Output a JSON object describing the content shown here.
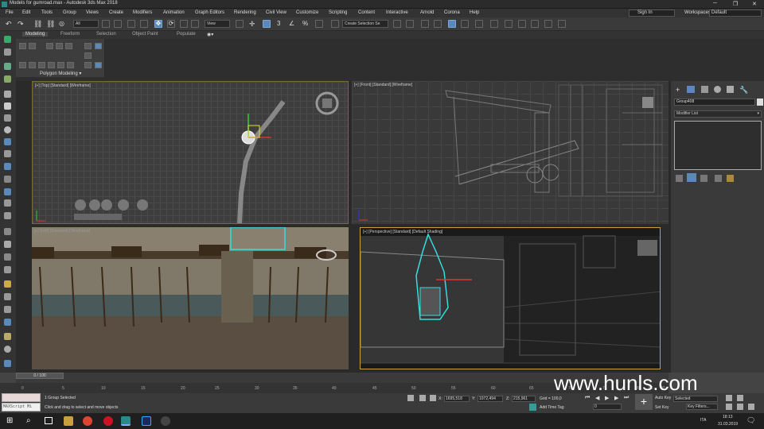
{
  "window": {
    "title": "Models for gumroad.max - Autodesk 3ds Max 2018",
    "min": "─",
    "max": "❐",
    "close": "✕"
  },
  "menu": [
    "File",
    "Edit",
    "Tools",
    "Group",
    "Views",
    "Create",
    "Modifiers",
    "Animation",
    "Graph Editors",
    "Rendering",
    "Civil View",
    "Customize",
    "Scripting",
    "Content",
    "Interactive",
    "Arnold",
    "Corona",
    "Help"
  ],
  "account": {
    "signin": "Sign In",
    "workspaces_label": "Workspaces:",
    "workspace": "Default"
  },
  "toolbar": {
    "filter": "All",
    "ref_coord": "View",
    "selection_set": "Create Selection Se"
  },
  "ribbon": {
    "tabs": [
      "Modeling",
      "Freeform",
      "Selection",
      "Object Paint",
      "Populate"
    ],
    "group": "Polygon Modeling"
  },
  "viewports": {
    "top": "[+] [Top] [Standard] [Wireframe]",
    "front": "[+] [Front] [Standard] [Wireframe]",
    "left": "[+] [Left] [Standard] [Wireframe]",
    "persp": "[+] [Perspective] [Standard] [Default Shading]"
  },
  "command_panel": {
    "object_name": "Group408",
    "modifier_list": "Modifier List"
  },
  "timeline": {
    "slider": "0 / 100",
    "ticks": [
      "0",
      "5",
      "10",
      "15",
      "20",
      "25",
      "30",
      "35",
      "40",
      "45",
      "50",
      "55",
      "60",
      "65",
      "70",
      "75",
      "80",
      "85",
      "90"
    ]
  },
  "status": {
    "maxscript": "MAXScript Mi",
    "selected": "1 Group Selected",
    "prompt": "Click and drag to select and move objects",
    "x_label": "X:",
    "x": "1695,518",
    "y_label": "Y:",
    "y": "1072,494",
    "z_label": "Z:",
    "z": "215,961",
    "grid": "Grid = 100,0",
    "add_time_tag": "Add Time Tag",
    "auto_key": "Auto Key",
    "selected_dd": "Selected",
    "set_key": "Set Key",
    "key_filters": "Key Filters...",
    "frame": "0"
  },
  "taskbar": {
    "time": "18:13",
    "date": "31.03.2019",
    "lang": "ITA"
  },
  "watermark": "www.hunls.com"
}
